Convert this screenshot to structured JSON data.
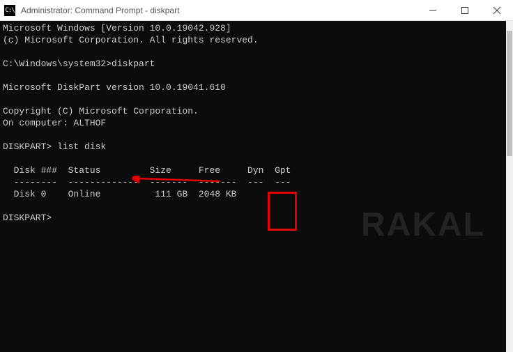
{
  "titlebar": {
    "icon_text": "C:\\",
    "title": "Administrator: Command Prompt - diskpart"
  },
  "terminal": {
    "line1": "Microsoft Windows [Version 10.0.19042.928]",
    "line2": "(c) Microsoft Corporation. All rights reserved.",
    "blank1": "",
    "line3": "C:\\Windows\\system32>diskpart",
    "blank2": "",
    "line4": "Microsoft DiskPart version 10.0.19041.610",
    "blank3": "",
    "line5": "Copyright (C) Microsoft Corporation.",
    "line6": "On computer: ALTHOF",
    "blank4": "",
    "line7": "DISKPART> list disk",
    "blank5": "",
    "header": "  Disk ###  Status         Size     Free     Dyn  Gpt",
    "divider": "  --------  -------------  -------  -------  ---  ---",
    "row": "  Disk 0    Online          111 GB  2048 KB",
    "blank6": "",
    "line8": "DISKPART>"
  },
  "watermark": "RAKAL"
}
